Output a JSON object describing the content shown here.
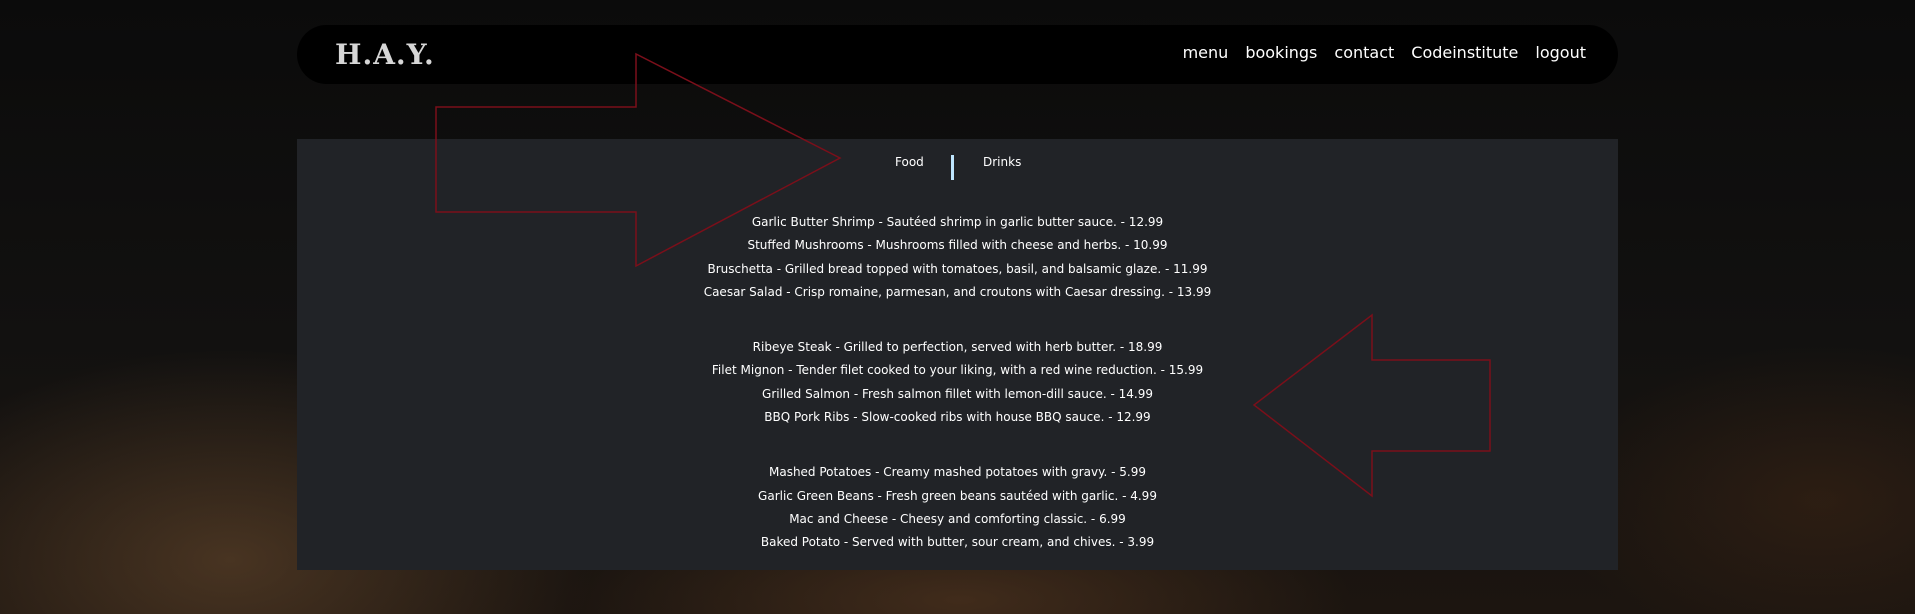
{
  "brand": {
    "logo": "H.A.Y."
  },
  "nav": {
    "items": [
      "menu",
      "bookings",
      "contact",
      "Codeinstitute",
      "logout"
    ]
  },
  "tabs": {
    "food": "Food",
    "drinks": "Drinks"
  },
  "menu": {
    "sections": [
      {
        "items": [
          "Garlic Butter Shrimp - Sautéed shrimp in garlic butter sauce. - 12.99",
          "Stuffed Mushrooms - Mushrooms filled with cheese and herbs. - 10.99",
          "Bruschetta - Grilled bread topped with tomatoes, basil, and balsamic glaze. - 11.99",
          "Caesar Salad - Crisp romaine, parmesan, and croutons with Caesar dressing. - 13.99"
        ]
      },
      {
        "items": [
          "Ribeye Steak - Grilled to perfection, served with herb butter. - 18.99",
          "Filet Mignon - Tender filet cooked to your liking, with a red wine reduction. - 15.99",
          "Grilled Salmon - Fresh salmon fillet with lemon-dill sauce. - 14.99",
          "BBQ Pork Ribs - Slow-cooked ribs with house BBQ sauce. - 12.99"
        ]
      },
      {
        "items": [
          "Mashed Potatoes - Creamy mashed potatoes with gravy. - 5.99",
          "Garlic Green Beans - Fresh green beans sautéed with garlic. - 4.99",
          "Mac and Cheese - Cheesy and comforting classic. - 6.99",
          "Baked Potato - Served with butter, sour cream, and chives. - 3.99"
        ]
      }
    ]
  },
  "colors": {
    "navbar_bg": "#000000",
    "panel_bg": "#212327",
    "tab_divider": "#bfe6ff",
    "annotation_arrow": "#7a0f1a"
  },
  "icons": {
    "annotation_right": "arrow-right-outline-icon",
    "annotation_left": "arrow-left-outline-icon"
  }
}
